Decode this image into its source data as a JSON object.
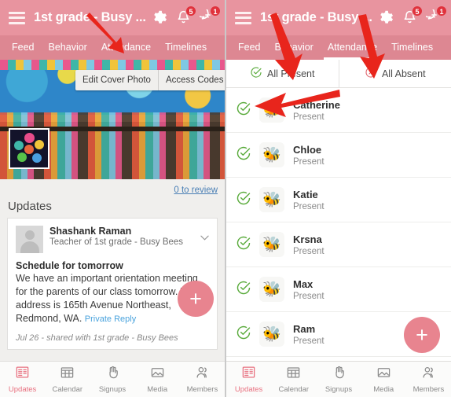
{
  "app": {
    "title": "1st grade - Busy ...",
    "menu_icon": "hamburger-icon",
    "settings_icon": "gear-icon",
    "notifications_icon": "bell-icon",
    "messages_icon": "chat-bubble-icon",
    "notifications_badge": "5",
    "messages_badge": "1",
    "accent_color": "#e8949f",
    "tabbar_color": "#dd8792"
  },
  "tabs": [
    {
      "label": "Feed",
      "active": false
    },
    {
      "label": "Behavior",
      "active": false
    },
    {
      "label": "Attendance",
      "active": false
    },
    {
      "label": "Timelines",
      "active": false
    }
  ],
  "tabs_right": [
    {
      "label": "Feed",
      "active": false
    },
    {
      "label": "Behavior",
      "active": false
    },
    {
      "label": "Attendance",
      "active": true
    },
    {
      "label": "Timelines",
      "active": false
    }
  ],
  "cover": {
    "edit_button": "Edit Cover Photo",
    "access_button": "Access Codes",
    "avatar_name": "class-avatar"
  },
  "left": {
    "review_link": "0 to review",
    "updates_heading": "Updates",
    "post": {
      "author": "Shashank Raman",
      "role": "Teacher of 1st grade - Busy Bees",
      "title": "Schedule for tomorrow",
      "body": "We have an important orientation meeting for the parents of our class tomorrow. The address is 165th Avenue Northeast, Redmond, WA.",
      "private_reply": "Private Reply",
      "meta": "Jul 26 - shared with 1st grade - Busy Bees"
    }
  },
  "attendance": {
    "all_present_label": "All Present",
    "all_absent_label": "All Absent",
    "present_color": "#5aab3c",
    "absent_color": "#e06a72",
    "students": [
      {
        "name": "Catherine",
        "status": "Present",
        "avatar": "🐝"
      },
      {
        "name": "Chloe",
        "status": "Present",
        "avatar": "🐝"
      },
      {
        "name": "Katie",
        "status": "Present",
        "avatar": "🐝"
      },
      {
        "name": "Krsna",
        "status": "Present",
        "avatar": "🐝"
      },
      {
        "name": "Max",
        "status": "Present",
        "avatar": "🐝"
      },
      {
        "name": "Ram",
        "status": "Present",
        "avatar": "🐝"
      }
    ]
  },
  "fab": {
    "label": "+",
    "color": "#e8848f"
  },
  "bottomnav": [
    {
      "label": "Updates",
      "icon": "newspaper-icon",
      "active": true
    },
    {
      "label": "Calendar",
      "icon": "calendar-icon",
      "active": false
    },
    {
      "label": "Signups",
      "icon": "hand-icon",
      "active": false
    },
    {
      "label": "Media",
      "icon": "image-icon",
      "active": false
    },
    {
      "label": "Members",
      "icon": "people-icon",
      "active": false
    }
  ],
  "annotations": {
    "arrow_color": "#e8251c",
    "arrows": [
      {
        "name": "arrow-to-attendance-tab-left"
      },
      {
        "name": "arrow-to-all-present-right"
      },
      {
        "name": "arrow-to-all-absent-right"
      },
      {
        "name": "arrow-to-student-row-right"
      }
    ]
  }
}
